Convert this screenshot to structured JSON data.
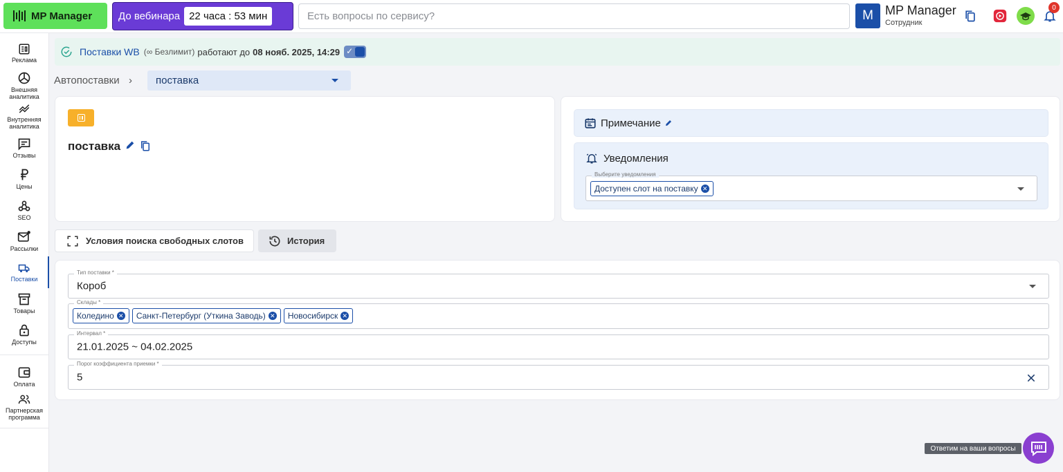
{
  "topbar": {
    "logo_label": "MP Manager",
    "webinar_label": "До вебинара",
    "webinar_timer": "22 часа : 53 мин",
    "search_placeholder": "Есть вопросы по сервису?",
    "avatar_letter": "M",
    "user_name": "MP Manager",
    "user_role": "Сотрудник",
    "notifications_count": "0"
  },
  "sidebar": {
    "items": [
      {
        "label": "Реклама",
        "icon": "ads-icon"
      },
      {
        "label": "Внешняя аналитика",
        "icon": "chart-pie-icon"
      },
      {
        "label": "Внутренняя аналитика",
        "icon": "trend-icon"
      },
      {
        "label": "Отзывы",
        "icon": "chat-icon"
      },
      {
        "label": "Цены",
        "icon": "ruble-icon"
      },
      {
        "label": "SEO",
        "icon": "webhook-icon"
      },
      {
        "label": "Рассылки",
        "icon": "mail-icon"
      },
      {
        "label": "Поставки",
        "icon": "truck-icon"
      },
      {
        "label": "Товары",
        "icon": "archive-icon"
      },
      {
        "label": "Доступы",
        "icon": "lock-icon"
      },
      {
        "label": "Оплата",
        "icon": "wallet-icon"
      },
      {
        "label": "Партнерская программа",
        "icon": "people-icon"
      }
    ],
    "active": "Поставки"
  },
  "banner": {
    "title": "Поставки WB",
    "plan": "(∞ Безлимит)",
    "text": "работают до",
    "until": "08 нояб. 2025, 14:29",
    "toggle_on": true
  },
  "breadcrumb": {
    "root": "Автопоставки",
    "separator": "›",
    "current": "поставка"
  },
  "supply_card": {
    "name": "поставка"
  },
  "side_card": {
    "note_title": "Примечание",
    "notif_title": "Уведомления",
    "notif_field_label": "Выберите уведомления",
    "notif_chips": [
      "Доступен слот на поставку"
    ]
  },
  "tabs": [
    {
      "label": "Условия поиска свободных слотов",
      "active": true
    },
    {
      "label": "История",
      "active": false
    }
  ],
  "form": {
    "supply_type_label": "Тип поставки *",
    "supply_type_value": "Короб",
    "warehouses_label": "Склады *",
    "warehouses": [
      "Коледино",
      "Санкт-Петербург (Уткина Заводь)",
      "Новосибирск"
    ],
    "interval_label": "Интервал *",
    "interval_value": "21.01.2025 ~ 04.02.2025",
    "threshold_label": "Порог коэффициента приемки *",
    "threshold_value": "5"
  },
  "help": {
    "label": "Ответим на ваши вопросы"
  },
  "colors": {
    "brand_green": "#5ee05a",
    "webinar_purple": "#6a3bd6",
    "primary_blue": "#1b4fa8",
    "pause_orange": "#f7b02a",
    "help_purple": "#8a3fd0"
  }
}
